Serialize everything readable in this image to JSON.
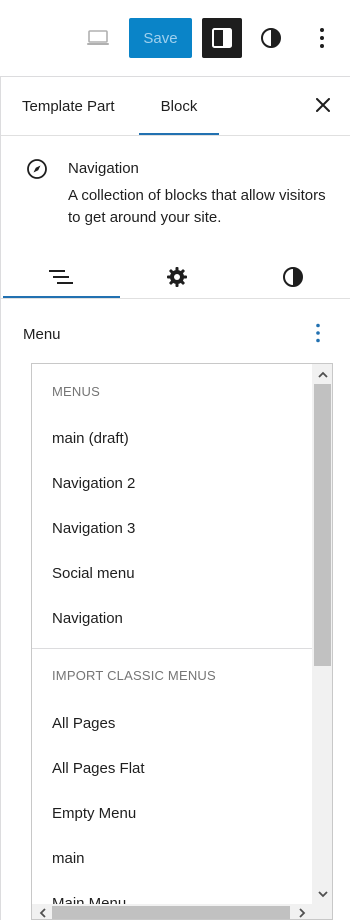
{
  "toolbar": {
    "device_icon": "laptop-icon",
    "save_label": "Save",
    "settings_icon": "sidebar-toggle-icon",
    "styles_icon": "half-circle-icon",
    "more_icon": "vertical-ellipsis-icon",
    "accent": "#0a84c8"
  },
  "sidebar": {
    "tabs": [
      {
        "label": "Template Part"
      },
      {
        "label": "Block"
      }
    ],
    "close_icon": "close-icon"
  },
  "block": {
    "icon": "compass-icon",
    "title": "Navigation",
    "description": "A collection of blocks that allow visitors to get around your site."
  },
  "inspector_tabs": [
    {
      "name": "list-view",
      "icon": "list-view-icon"
    },
    {
      "name": "settings",
      "icon": "gear-icon"
    },
    {
      "name": "styles",
      "icon": "half-circle-icon"
    }
  ],
  "menu": {
    "label": "Menu",
    "options_icon": "vertical-ellipsis-icon"
  },
  "dropdown": {
    "menus_heading": "MENUS",
    "menus": [
      "main (draft)",
      "Navigation 2",
      "Navigation 3",
      "Social menu",
      "Navigation"
    ],
    "import_heading": "IMPORT CLASSIC MENUS",
    "classic_menus": [
      "All Pages",
      "All Pages Flat",
      "Empty Menu",
      "main",
      "Main Menu"
    ]
  }
}
